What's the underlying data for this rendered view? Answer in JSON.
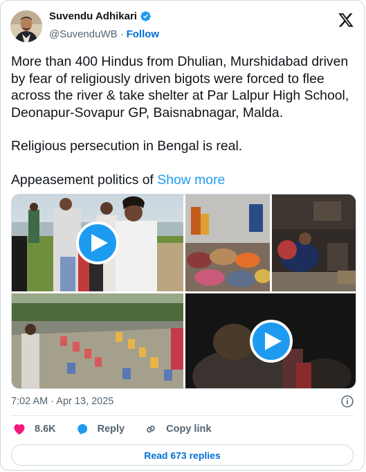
{
  "author": {
    "name": "Suvendu Adhikari",
    "handle": "@SuvenduWB",
    "separator": "·",
    "follow_label": "Follow"
  },
  "tweet": {
    "paragraph1": "More than 400 Hindus from Dhulian, Murshidabad driven by fear of religiously driven bigots were forced to flee across the river & take shelter at Par Lalpur High School, Deonapur-Sovapur GP, Baisnabnagar, Malda.",
    "paragraph2": "Religious persecution in Bengal is real.",
    "paragraph3": "Appeasement politics of",
    "show_more_label": "Show more"
  },
  "meta": {
    "timestamp": "7:02 AM · Apr 13, 2025"
  },
  "actions": {
    "like_count": "8.6K",
    "reply_label": "Reply",
    "copy_link_label": "Copy link"
  },
  "read_replies_label": "Read 673 replies",
  "colors": {
    "accent": "#1d9bf0",
    "link_blue": "#006fd6",
    "like_pink": "#f91880",
    "muted_text": "#536471"
  },
  "icons": [
    "verified-badge-icon",
    "x-logo-icon",
    "play-icon",
    "info-icon",
    "heart-icon",
    "reply-icon",
    "copy-link-icon"
  ]
}
